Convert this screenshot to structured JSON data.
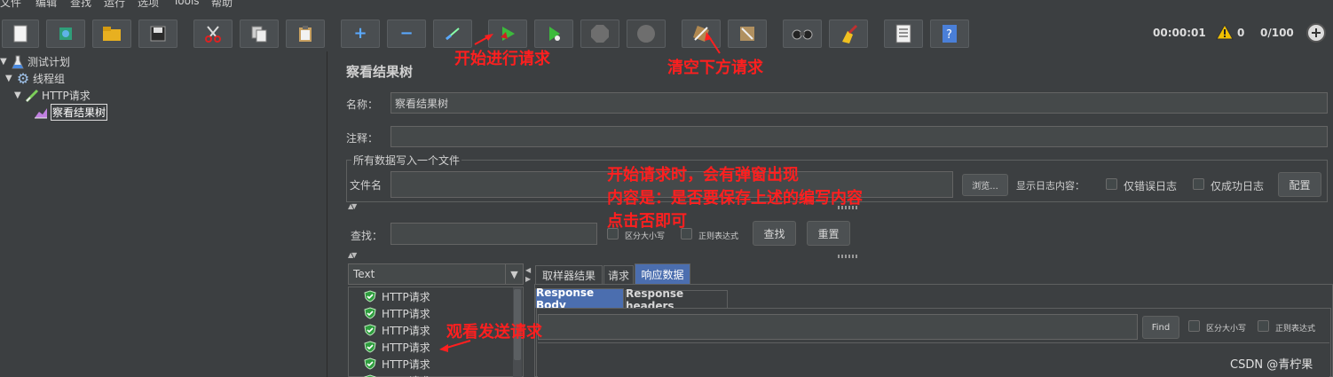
{
  "menu": [
    "文件",
    "编辑",
    "查找",
    "运行",
    "选项",
    "Tools",
    "帮助"
  ],
  "status": {
    "elapsed": "00:00:01",
    "warnings": "0",
    "threads": "0/100"
  },
  "tree": {
    "items": [
      {
        "label": "测试计划",
        "icon": "flask-icon"
      },
      {
        "label": "线程组",
        "icon": "gear-icon"
      },
      {
        "label": "HTTP请求",
        "icon": "pipette-icon"
      },
      {
        "label": "察看结果树",
        "icon": "chart-icon"
      }
    ]
  },
  "panel": {
    "title": "察看结果树",
    "name_label": "名称：",
    "name_value": "察看结果树",
    "comment_label": "注释：",
    "comment_value": "",
    "file_group_title": "所有数据写入一个文件",
    "filename_label": "文件名",
    "filename_value": "",
    "browse_label": "浏览...",
    "log_content_label": "显示日志内容：",
    "errors_only_label": "仅错误日志",
    "success_only_label": "仅成功日志",
    "configure_label": "配置",
    "search_label": "查找：",
    "search_value": "",
    "case_sensitive_label": "区分大小写",
    "regex_label": "正则表达式",
    "find_label": "查找",
    "reset_label": "重置"
  },
  "results": {
    "renderer": "Text",
    "items": [
      "HTTP请求",
      "HTTP请求",
      "HTTP请求",
      "HTTP请求",
      "HTTP请求",
      "HTTP请求"
    ]
  },
  "tabs": [
    "取样器结果",
    "请求",
    "响应数据"
  ],
  "subtabs": [
    "Response Body",
    "Response headers"
  ],
  "response": {
    "search_value": "",
    "find_label": "Find",
    "case_sensitive_label": "区分大小写",
    "regex_label": "正则表达式"
  },
  "annotations": {
    "start": "开始进行请求",
    "clear": "清空下方请求",
    "popup_line1": "开始请求时，会有弹窗出现",
    "popup_line2": "内容是：是否要保存上述的编写内容",
    "popup_line3": "点击否即可",
    "watch": "观看发送请求"
  },
  "watermark": "CSDN @青柠果",
  "colors": {
    "accent": "#4b6eaf",
    "annotation": "#ff1f1f",
    "ok": "#2e9e3e",
    "warning": "#f0c000"
  }
}
